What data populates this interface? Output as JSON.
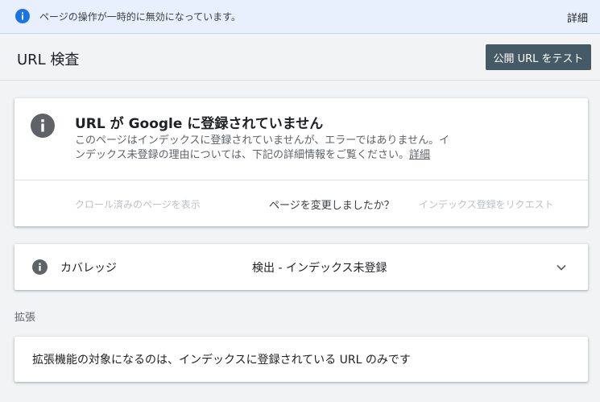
{
  "banner": {
    "icon": "info-icon",
    "message": "ページの操作が一時的に無効になっています。",
    "link_label": "詳細"
  },
  "header": {
    "title": "URL 検査",
    "test_button_label": "公開 URL をテスト"
  },
  "status_card": {
    "icon": "info-icon",
    "title": "URL が Google に登録されていません",
    "description_line1": "このページはインデックスに登録されていませんが、エラーではありません。イ",
    "description_line2": "ンデックス未登録の理由については、下記の詳細情報をご覧ください。",
    "more_link": "詳細",
    "crawl_link": "クロール済みのページを表示",
    "changed_question": "ページを変更しましたか？",
    "request_link": "インデックス登録をリクエスト"
  },
  "coverage": {
    "icon": "info-icon",
    "label": "カバレッジ",
    "value": "検出 - インデックス未登録",
    "chevron": "chevron-down-icon"
  },
  "enhancements": {
    "section_label": "拡張",
    "text": "拡張機能の対象になるのは、インデックスに登録されている URL のみです"
  },
  "colors": {
    "banner_bg": "#e8f0fe",
    "accent_blue": "#1a73e8",
    "button_bg": "#455a64",
    "icon_gray": "#5f6368",
    "disabled_text": "#bdc1c6"
  }
}
